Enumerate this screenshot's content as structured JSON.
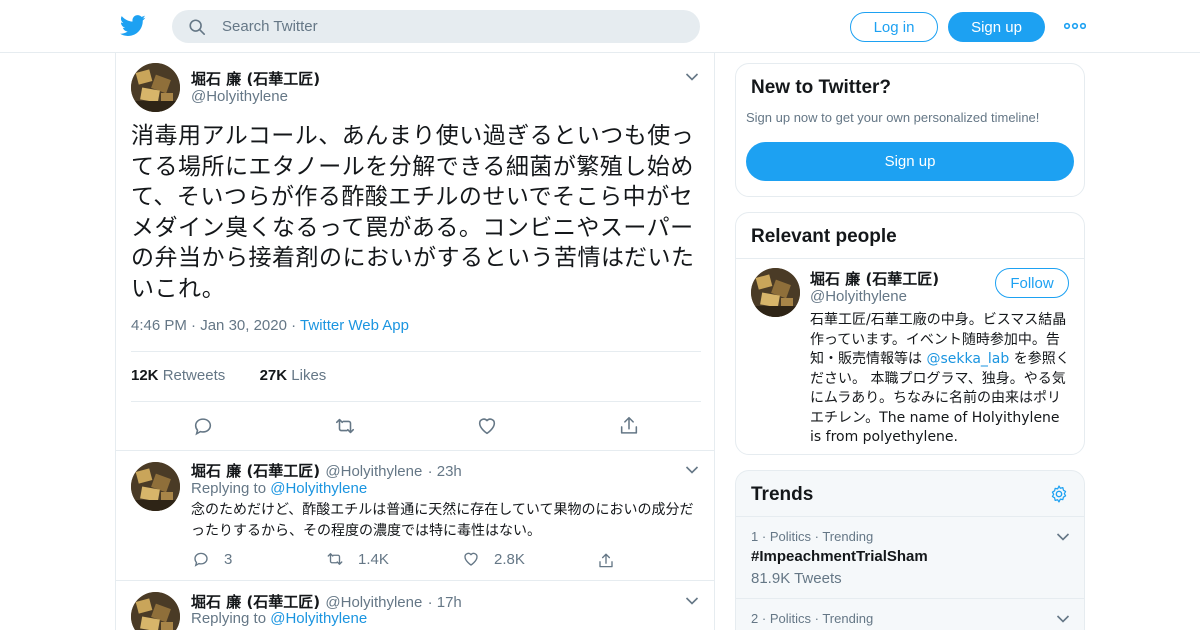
{
  "header": {
    "search_placeholder": "Search Twitter",
    "login_label": "Log in",
    "signup_label": "Sign up"
  },
  "tweet": {
    "author_name": "堀石 廉 (石華工匠)",
    "author_handle": "@Holyithylene",
    "text": "消毒用アルコール、あんまり使い過ぎるといつも使ってる場所にエタノールを分解できる細菌が繁殖し始めて、そいつらが作る酢酸エチルのせいでそこら中がセメダイン臭くなるって罠がある。コンビニやスーパーの弁当から接着剤のにおいがするという苦情はだいたいこれ。",
    "time": "4:46 PM",
    "date": "Jan 30, 2020",
    "source": "Twitter Web App",
    "retweets_count": "12K",
    "retweets_label": "Retweets",
    "likes_count": "27K",
    "likes_label": "Likes"
  },
  "replies": [
    {
      "author_name": "堀石 廉 (石華工匠)",
      "author_handle": "@Holyithylene",
      "age": "23h",
      "replying_label": "Replying to",
      "replying_to": "@Holyithylene",
      "text": "念のためだけど、酢酸エチルは普通に天然に存在していて果物のにおいの成分だったりするから、その程度の濃度では特に毒性はない。",
      "reply_count": "3",
      "retweet_count": "1.4K",
      "like_count": "2.8K"
    },
    {
      "author_name": "堀石 廉 (石華工匠)",
      "author_handle": "@Holyithylene",
      "age": "17h",
      "replying_label": "Replying to",
      "replying_to": "@Holyithylene"
    }
  ],
  "sidebar": {
    "new_to_twitter": {
      "title": "New to Twitter?",
      "subtitle": "Sign up now to get your own personalized timeline!",
      "button": "Sign up"
    },
    "relevant_people": {
      "title": "Relevant people",
      "name": "堀石 廉 (石華工匠)",
      "handle": "@Holyithylene",
      "follow_label": "Follow",
      "bio_part1": "石華工匠/石華工廠の中身。ビスマス結晶作っています。イベント随時参加中。告知・販売情報等は ",
      "bio_link": "@sekka_lab",
      "bio_part2": " を参照ください。 本職プログラマ、独身。やる気にムラあり。ちなみに名前の由来はポリエチレン。The name of Holyithylene is from polyethylene."
    },
    "trends": {
      "title": "Trends",
      "items": [
        {
          "rank": "1",
          "category": "Politics",
          "status": "Trending",
          "name": "#ImpeachmentTrialSham",
          "count": "81.9K Tweets"
        },
        {
          "rank": "2",
          "category": "Politics",
          "status": "Trending"
        }
      ]
    }
  },
  "colors": {
    "brand": "#1da1f2",
    "link": "#1b95e0",
    "muted": "#657786",
    "border": "#e6ecf0"
  },
  "icons": [
    "twitter-bird-icon",
    "search-icon",
    "more-dots-icon",
    "chevron-down-icon",
    "reply-icon",
    "retweet-icon",
    "like-icon",
    "share-icon",
    "gear-icon"
  ]
}
